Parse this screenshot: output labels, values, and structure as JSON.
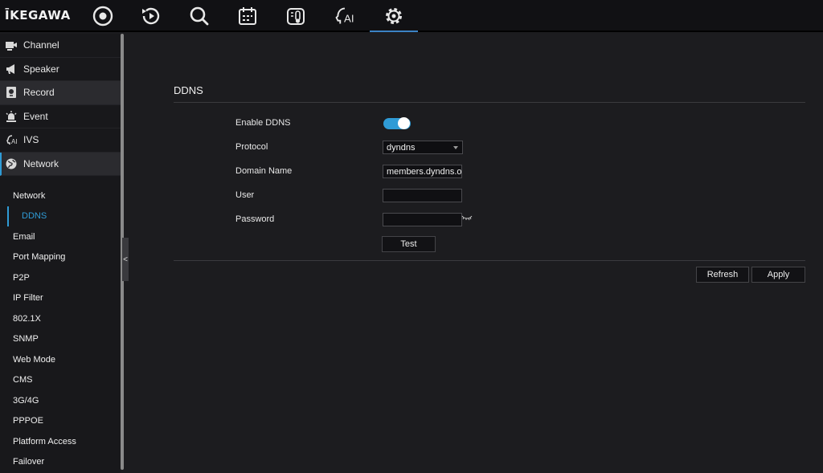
{
  "app": {
    "logo": "ĪKEGAWA"
  },
  "topnav": [
    {
      "name": "live-view-icon"
    },
    {
      "name": "playback-icon"
    },
    {
      "name": "search-icon"
    },
    {
      "name": "calendar-icon"
    },
    {
      "name": "temperature-icon"
    },
    {
      "name": "ai-icon",
      "text": "AI"
    },
    {
      "name": "settings-icon"
    }
  ],
  "sidebar": {
    "items": [
      {
        "label": "Channel",
        "icon": "camera-icon"
      },
      {
        "label": "Speaker",
        "icon": "megaphone-icon"
      },
      {
        "label": "Record",
        "icon": "record-icon"
      },
      {
        "label": "Event",
        "icon": "alarm-icon"
      },
      {
        "label": "IVS",
        "icon": "ivs-icon"
      },
      {
        "label": "Network",
        "icon": "globe-icon"
      }
    ],
    "submenu": [
      "Network",
      "DDNS",
      "Email",
      "Port Mapping",
      "P2P",
      "IP Filter",
      "802.1X",
      "SNMP",
      "Web Mode",
      "CMS",
      "3G/4G",
      "PPPOE",
      "Platform Access",
      "Failover"
    ],
    "collapse_glyph": "<"
  },
  "ddns": {
    "title": "DDNS",
    "labels": {
      "enable": "Enable DDNS",
      "protocol": "Protocol",
      "domain": "Domain Name",
      "user": "User",
      "password": "Password"
    },
    "enabled": true,
    "protocol_value": "dyndns",
    "domain_value": "members.dyndns.or",
    "user_value": "",
    "password_value": "",
    "test_label": "Test",
    "refresh_label": "Refresh",
    "apply_label": "Apply"
  },
  "colors": {
    "accent": "#2f9bd6",
    "background": "#1c1c1f",
    "topbar": "#111114"
  }
}
